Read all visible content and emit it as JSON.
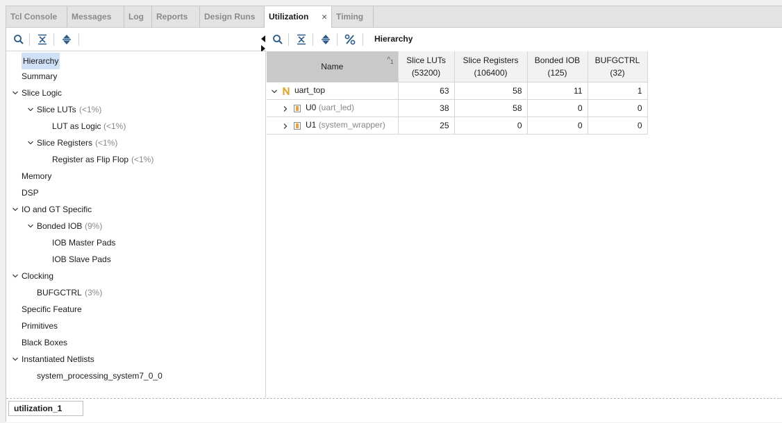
{
  "tabs": [
    {
      "label": "Tcl Console",
      "active": false
    },
    {
      "label": "Messages",
      "active": false
    },
    {
      "label": "Log",
      "active": false
    },
    {
      "label": "Reports",
      "active": false
    },
    {
      "label": "Design Runs",
      "active": false
    },
    {
      "label": "Utilization",
      "active": true
    },
    {
      "label": "Timing",
      "active": false
    }
  ],
  "tab_close_glyph": "×",
  "left_tree": [
    {
      "label": "Hierarchy",
      "pct": "",
      "selected": true
    },
    {
      "label": "Summary",
      "pct": ""
    },
    {
      "label": "Slice Logic",
      "pct": "",
      "expanded": true
    },
    {
      "label": "Slice LUTs",
      "pct": "(<1%)",
      "expanded": true
    },
    {
      "label": "LUT as Logic",
      "pct": "(<1%)"
    },
    {
      "label": "Slice Registers",
      "pct": "(<1%)",
      "expanded": true
    },
    {
      "label": "Register as Flip Flop",
      "pct": "(<1%)"
    },
    {
      "label": "Memory",
      "pct": ""
    },
    {
      "label": "DSP",
      "pct": ""
    },
    {
      "label": "IO and GT Specific",
      "pct": "",
      "expanded": true
    },
    {
      "label": "Bonded IOB",
      "pct": "(9%)",
      "expanded": true
    },
    {
      "label": "IOB Master Pads",
      "pct": ""
    },
    {
      "label": "IOB Slave Pads",
      "pct": ""
    },
    {
      "label": "Clocking",
      "pct": "",
      "expanded": true
    },
    {
      "label": "BUFGCTRL",
      "pct": "(3%)"
    },
    {
      "label": "Specific Feature",
      "pct": ""
    },
    {
      "label": "Primitives",
      "pct": ""
    },
    {
      "label": "Black Boxes",
      "pct": ""
    },
    {
      "label": "Instantiated Netlists",
      "pct": "",
      "expanded": true
    },
    {
      "label": "system_processing_system7_0_0",
      "pct": ""
    }
  ],
  "right_title": "Hierarchy",
  "table": {
    "headers": [
      {
        "line1": "Name",
        "line2": ""
      },
      {
        "line1": "Slice LUTs",
        "line2": "(53200)"
      },
      {
        "line1": "Slice Registers",
        "line2": "(106400)"
      },
      {
        "line1": "Bonded IOB",
        "line2": "(125)"
      },
      {
        "line1": "BUFGCTRL",
        "line2": "(32)"
      }
    ],
    "sort_indicator": "^",
    "sort_index": "1",
    "rows": [
      {
        "name": "uart_top",
        "module": "",
        "values": [
          "63",
          "58",
          "11",
          "1"
        ],
        "expanded": true
      },
      {
        "name": "U0",
        "module": "(uart_led)",
        "values": [
          "38",
          "58",
          "0",
          "0"
        ],
        "expanded": false
      },
      {
        "name": "U1",
        "module": "(system_wrapper)",
        "values": [
          "25",
          "0",
          "0",
          "0"
        ],
        "expanded": false
      }
    ]
  },
  "bottom_tab": "utilization_1",
  "colors": {
    "selected": "#cfe0f7",
    "name_header": "#c9c9c9",
    "module_icon": "#e8a33c",
    "top_icon": "#e8a020"
  }
}
